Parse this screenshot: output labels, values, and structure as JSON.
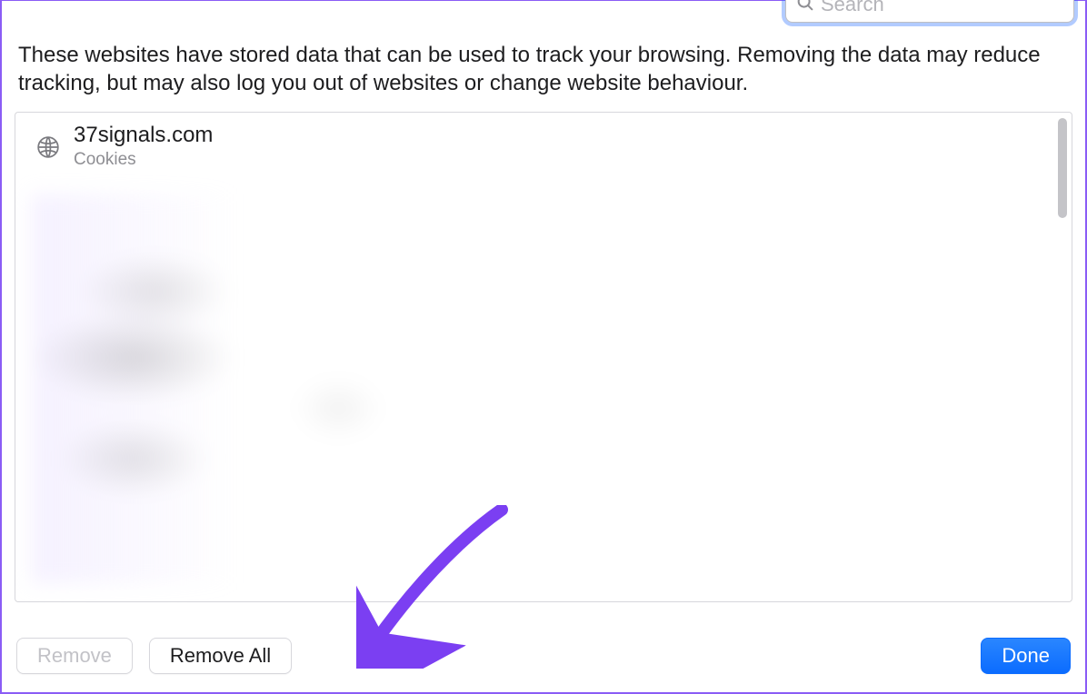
{
  "search": {
    "placeholder": "Search"
  },
  "description": "These websites have stored data that can be used to track your browsing. Removing the data may reduce tracking, but may also log you out of websites or change website behaviour.",
  "sites": [
    {
      "domain": "37signals.com",
      "detail": "Cookies"
    }
  ],
  "buttons": {
    "remove": "Remove",
    "remove_all": "Remove All",
    "done": "Done"
  },
  "annotation": {
    "color": "#7b3ff2"
  }
}
